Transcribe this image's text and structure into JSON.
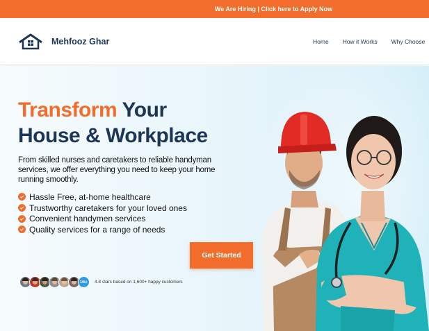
{
  "topbar": {
    "announcement": "We Are Hiring | Click here to Apply Now"
  },
  "header": {
    "logo_icon": "house-logo-icon",
    "brand": "Mehfooz Ghar",
    "nav": [
      {
        "label": "Home"
      },
      {
        "label": "How it Works"
      },
      {
        "label": "Why Choose"
      }
    ]
  },
  "hero": {
    "title_accent": "Transform",
    "title_rest_line1": " Your",
    "title_line2": "House & Workplace",
    "description": "From skilled nurses and caretakers to reliable handyman services, we offer everything you need to keep your home running smoothly.",
    "features": [
      "Hassle Free, at-home healthcare",
      "Trustworthy caretakers for your loved ones",
      "Convenient handymen services",
      "Quality services for a range of needs"
    ],
    "cta_label": "Get Started",
    "reviews": {
      "more_badge": "14k+",
      "text": "4.8 stars based on 1,600+ happy customers"
    },
    "image_subject": "handyman in red hard hat and nurse in teal scrubs with stethoscope"
  },
  "colors": {
    "accent": "#f26d2b",
    "navy": "#1d3557",
    "hero_bg": "#eaf6fb",
    "badge_blue": "#2e9be6"
  }
}
